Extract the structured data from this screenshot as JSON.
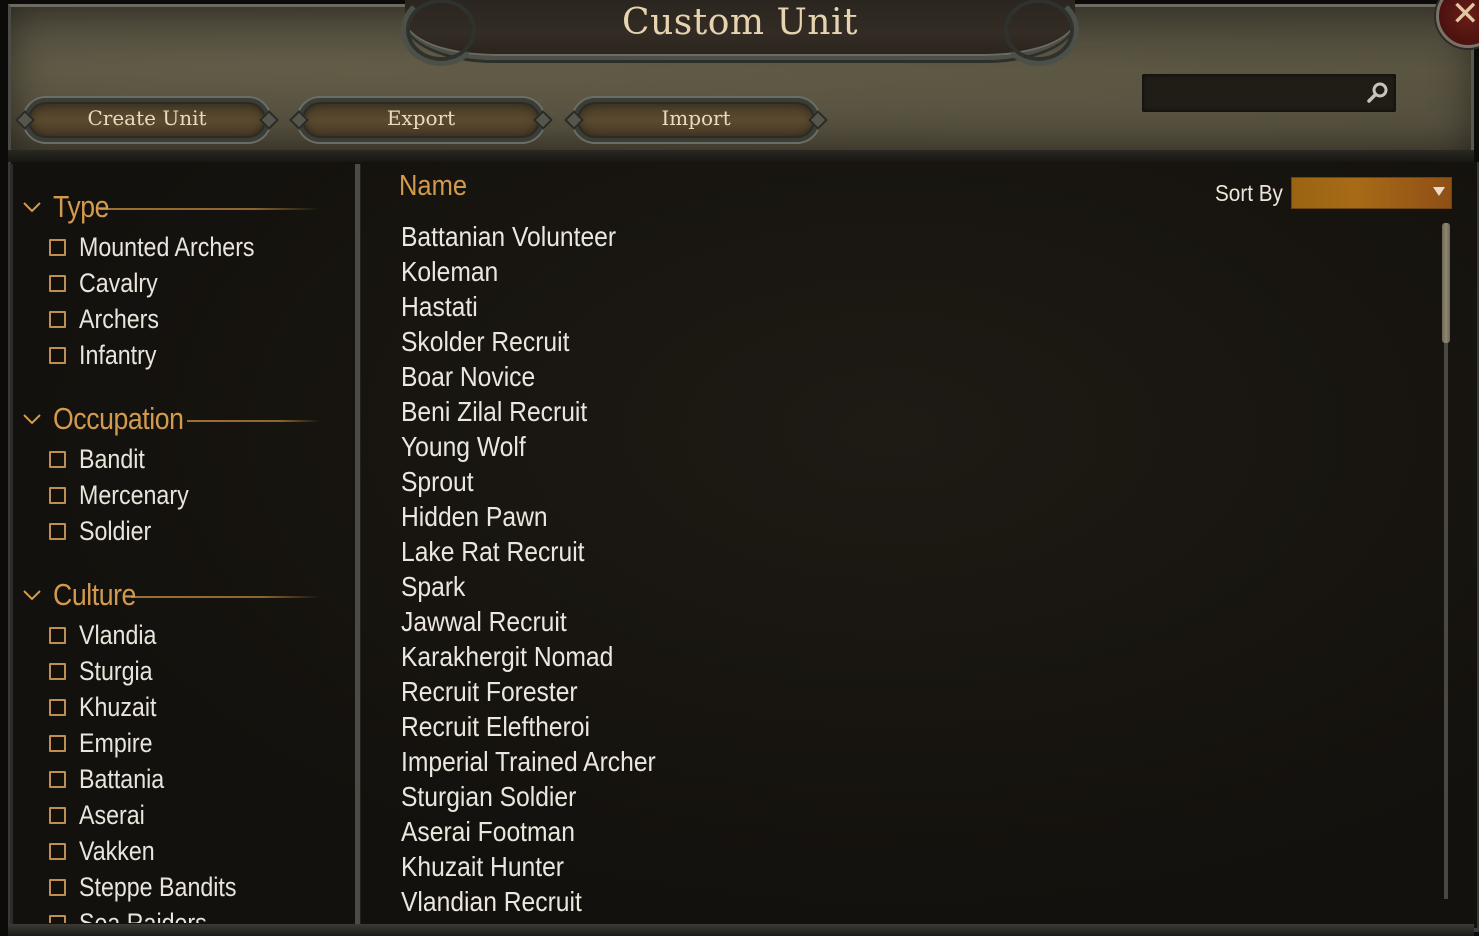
{
  "window": {
    "title": "Custom Unit",
    "close_icon": "close-icon"
  },
  "toolbar": {
    "buttons": [
      {
        "label": "Create Unit"
      },
      {
        "label": "Export"
      },
      {
        "label": "Import"
      }
    ]
  },
  "search": {
    "value": "",
    "placeholder": "",
    "icon": "search-icon"
  },
  "filters": {
    "groups": [
      {
        "title": "Type",
        "expanded": true,
        "options": [
          {
            "label": "Mounted Archers",
            "checked": false
          },
          {
            "label": "Cavalry",
            "checked": false
          },
          {
            "label": "Archers",
            "checked": false
          },
          {
            "label": "Infantry",
            "checked": false
          }
        ]
      },
      {
        "title": "Occupation",
        "expanded": true,
        "options": [
          {
            "label": "Bandit",
            "checked": false
          },
          {
            "label": "Mercenary",
            "checked": false
          },
          {
            "label": "Soldier",
            "checked": false
          }
        ]
      },
      {
        "title": "Culture",
        "expanded": true,
        "options": [
          {
            "label": "Vlandia",
            "checked": false
          },
          {
            "label": "Sturgia",
            "checked": false
          },
          {
            "label": "Khuzait",
            "checked": false
          },
          {
            "label": "Empire",
            "checked": false
          },
          {
            "label": "Battania",
            "checked": false
          },
          {
            "label": "Aserai",
            "checked": false
          },
          {
            "label": "Vakken",
            "checked": false
          },
          {
            "label": "Steppe Bandits",
            "checked": false
          },
          {
            "label": "Sea Raiders",
            "checked": false
          }
        ]
      }
    ]
  },
  "units": {
    "column_header": "Name",
    "sort_label": "Sort By",
    "sort_value": "",
    "items": [
      "Battanian Volunteer",
      "Koleman",
      "Hastati",
      "Skolder Recruit",
      "Boar Novice",
      "Beni Zilal Recruit",
      "Young Wolf",
      "Sprout",
      "Hidden Pawn",
      "Lake Rat Recruit",
      "Spark",
      "Jawwal Recruit",
      "Karakhergit Nomad",
      "Recruit Forester",
      "Recruit Eleftheroi",
      "Imperial Trained Archer",
      "Sturgian Soldier",
      "Aserai Footman",
      "Khuzait Hunter",
      "Vlandian Recruit"
    ]
  },
  "colors": {
    "accent_gold": "#d39a4f",
    "text_light": "#ebe7de",
    "sort_dropdown": "#a86b17",
    "close_red": "#6a1d18"
  }
}
